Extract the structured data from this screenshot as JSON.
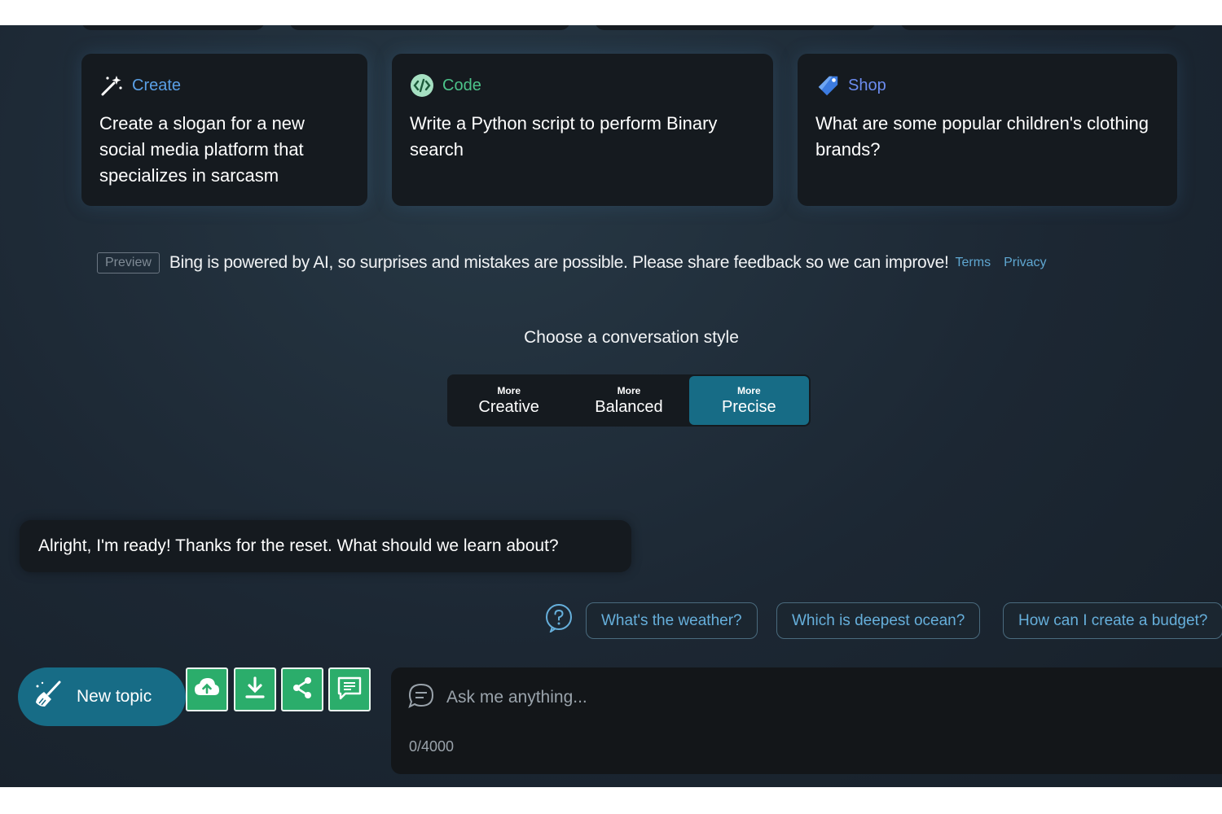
{
  "prompt_cards": [
    {
      "category": "Create",
      "category_color": "#5aa0e6",
      "icon": "magic-wand-icon",
      "text": "Create a slogan for a new social media platform that specializes in sarcasm"
    },
    {
      "category": "Code",
      "category_color": "#4cc38a",
      "icon": "code-icon",
      "text": "Write a Python script to perform Binary search"
    },
    {
      "category": "Shop",
      "category_color": "#6c8cf0",
      "icon": "shopping-tag-icon",
      "text": "What are some popular children's clothing brands?"
    }
  ],
  "disclaimer": {
    "badge": "Preview",
    "text": "Bing is powered by AI, so surprises and mistakes are possible. Please share feedback so we can improve!",
    "terms_link": "Terms",
    "privacy_link": "Privacy"
  },
  "conversation_style": {
    "title": "Choose a conversation style",
    "options": [
      {
        "prefix": "More",
        "name": "Creative"
      },
      {
        "prefix": "More",
        "name": "Balanced"
      },
      {
        "prefix": "More",
        "name": "Precise"
      }
    ],
    "selected": "Precise"
  },
  "bot_message": "Alright, I'm ready! Thanks for the reset. What should we learn about?",
  "suggestions": [
    "What's the weather?",
    "Which is deepest ocean?",
    "How can I create a budget?"
  ],
  "toolbar": {
    "new_topic_label": "New topic",
    "tools": [
      "cloud-upload-icon",
      "download-icon",
      "share-icon",
      "feedback-icon"
    ],
    "tool_color": "#2bad6b"
  },
  "input": {
    "placeholder": "Ask me anything...",
    "value": "",
    "counter": "0/4000"
  },
  "colors": {
    "accent": "#176c86",
    "background": "#1c2733",
    "card": "#151a1f",
    "link": "#5fa7d1"
  }
}
